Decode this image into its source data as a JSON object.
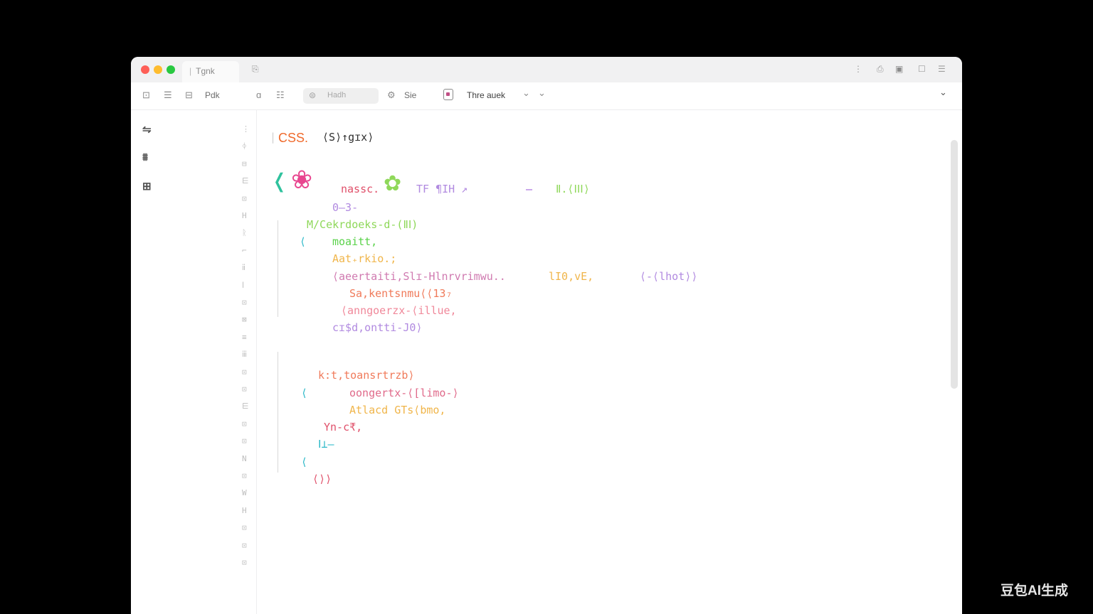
{
  "window": {
    "tab_title": "Tgnk",
    "tab2_icon": "⎘",
    "title_right": [
      "⋮",
      "⎙",
      "▣",
      "☐",
      "☰"
    ]
  },
  "toolbar": {
    "icons_left": [
      "⊡",
      "☰",
      "⊟"
    ],
    "file_label": "Pdk",
    "icon_a": "ɑ",
    "icon_b": "☷",
    "search_icon": "⊜",
    "search_text": "Hadh",
    "settings_icon": "⚙",
    "settings_label": "Sie",
    "theme_label": "Thre auek",
    "chevron_a": "⌄",
    "chevron_b": "⌄",
    "chevron_right": "⌄"
  },
  "sidebar": {
    "icons": [
      "⇋",
      "⩩",
      "⊞"
    ],
    "gutter": [
      "⋮",
      "ᛄ",
      "⊟",
      "⋿",
      "⊡",
      "H",
      "ᚱ",
      "⌐",
      "ⅱ",
      "ⅼ",
      "⊡",
      "⊠",
      "≡",
      "ⅲ",
      "⊡",
      "⊡",
      "⋿",
      "⊡",
      "⊡",
      "N",
      "⊡",
      "W",
      "H",
      "⊡",
      "⊡",
      "⊡"
    ]
  },
  "code": {
    "l1": "CSS.",
    "l1b": "⟨S⟩↑gɪx⟩",
    "bracket_open": "❬",
    "flower1": "❀",
    "l2a": "nassc.",
    "flower2": "✿",
    "l2b": "TF ¶ΙΗ ↗",
    "l2c": "–",
    "l2d": "Ⅱ.⟨ⅠⅠⅠ⟩",
    "l3": "0—3-",
    "l4": "M/Cekrdoeks-d-(ⅡⅠ)",
    "l5a": "⟨",
    "l5b": "moaitt,",
    "l6": "Aat₊rkio.;",
    "l7a": "⟨aeertaiti,Slɪ-Hlnrvrimwu..",
    "l7b": "lI0,vE,",
    "l7c": "⟨-⟨lhot⟩⟩",
    "l8": "Sa,kentsnmu⟨⟨13₇",
    "l9": "⟨anngoerzx-⟨illue,",
    "l10": "cɪ$d,ontti-J0⟩",
    "l11": "k:t,toansrtrzb⟩",
    "l12a": "⟨",
    "l12b": "oongertx-⟨[limo-⟩",
    "l13": "Atlacd GTs⟨bmo,",
    "l14": "Yn-c₹,",
    "l15": "Ⅰ⊥—",
    "l16": "⟨",
    "l17": "⟨⟩⟩"
  },
  "watermark": "豆包AI生成",
  "colors": {
    "orange": "#ef6a2c",
    "pink": "#e8468f",
    "green": "#5ad24a",
    "purple": "#b18ae0",
    "cyan": "#2bb8c8",
    "lightgreen": "#8fd85a",
    "yellow": "#f0b54a",
    "salmon": "#f07a5a"
  }
}
